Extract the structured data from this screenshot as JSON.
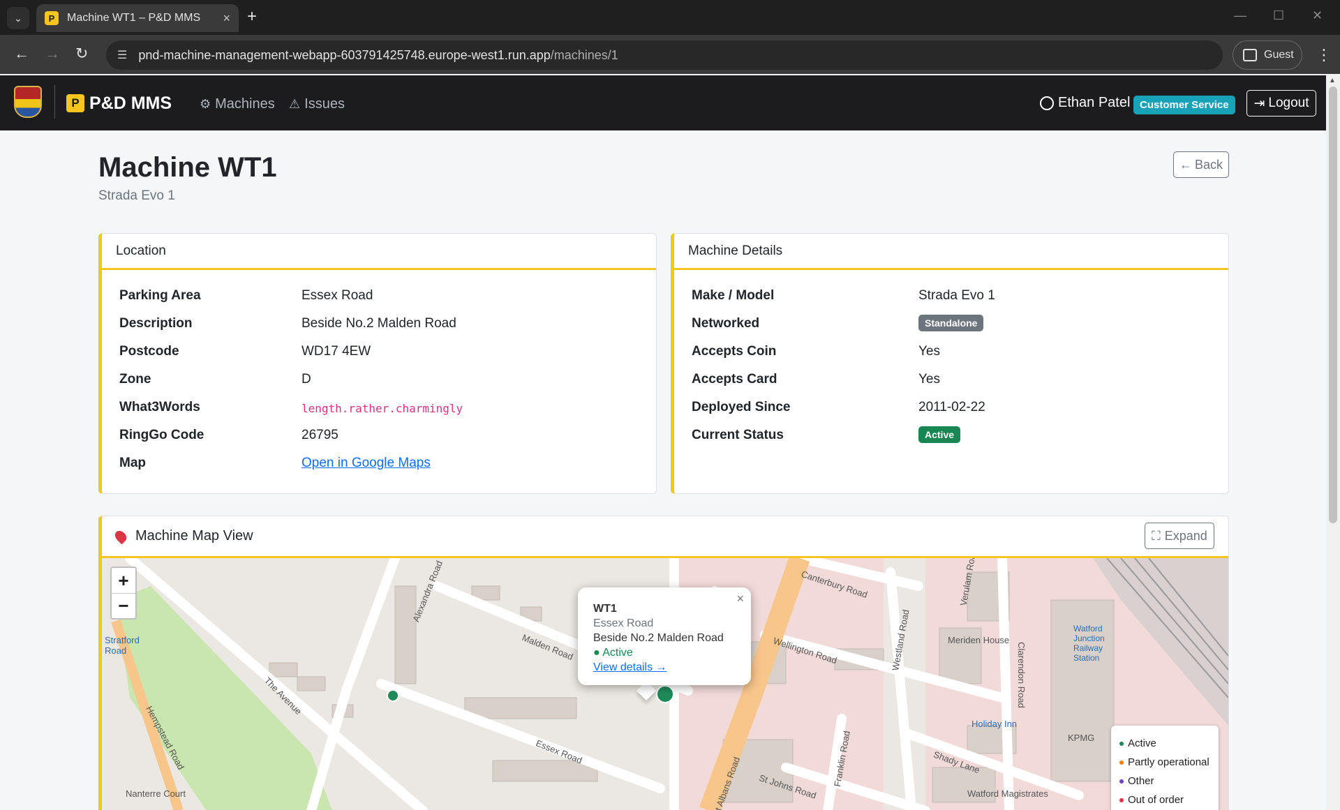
{
  "browser": {
    "tab_title": "Machine WT1 – P&D MMS",
    "url_host": "pnd-machine-management-webapp-603791425748.europe-west1.run.app",
    "url_path": "/machines/1",
    "profile_label": "Guest"
  },
  "navbar": {
    "brand_logo_letter": "P",
    "brand_name": "P&D MMS",
    "links": [
      {
        "label": "Machines",
        "icon": "cpu-icon"
      },
      {
        "label": "Issues",
        "icon": "warning-triangle-icon"
      }
    ],
    "user_name": "Ethan Patel",
    "user_role": "Customer Service",
    "logout_label": "Logout"
  },
  "page": {
    "title": "Machine WT1",
    "subtitle": "Strada Evo 1",
    "back_label": "Back"
  },
  "location_card": {
    "title": "Location",
    "rows": [
      {
        "label": "Parking Area",
        "value": "Essex Road"
      },
      {
        "label": "Description",
        "value": "Beside No.2 Malden Road"
      },
      {
        "label": "Postcode",
        "value": "WD17 4EW"
      },
      {
        "label": "Zone",
        "value": "D"
      },
      {
        "label": "What3Words",
        "value": "length.rather.charmingly"
      },
      {
        "label": "RingGo Code",
        "value": "26795"
      },
      {
        "label": "Map",
        "value": "Open in Google Maps"
      }
    ]
  },
  "details_card": {
    "title": "Machine Details",
    "rows": [
      {
        "label": "Make / Model",
        "value": "Strada Evo 1"
      },
      {
        "label": "Networked",
        "value": "Standalone"
      },
      {
        "label": "Accepts Coin",
        "value": "Yes"
      },
      {
        "label": "Accepts Card",
        "value": "Yes"
      },
      {
        "label": "Deployed Since",
        "value": "2011-02-22"
      },
      {
        "label": "Current Status",
        "value": "Active"
      }
    ]
  },
  "map_card": {
    "title": "Machine Map View",
    "expand_label": "Expand",
    "zoom_in": "+",
    "zoom_out": "−",
    "popup": {
      "title": "WT1",
      "area": "Essex Road",
      "description": "Beside No.2 Malden Road",
      "status": "● Active",
      "link": "View details →"
    },
    "legend": [
      {
        "label": "Active",
        "color": "#198754"
      },
      {
        "label": "Partly operational",
        "color": "#fd7e14"
      },
      {
        "label": "Other",
        "color": "#6f42c1"
      },
      {
        "label": "Out of order",
        "color": "#dc3545"
      }
    ],
    "labels": [
      "Malden Road",
      "Essex Road",
      "The Avenue",
      "Hempstead Road",
      "Alexandra Road",
      "Wellington Road",
      "Canterbury Road",
      "Westland Road",
      "Clarendon Road",
      "Shady Lane",
      "St Johns Road",
      "Franklin Road",
      "St Albans Road",
      "Meriden House",
      "KPMG",
      "Holiday Inn",
      "Watford Junction Railway Station",
      "Watford Magistrates",
      "Stratford Road",
      "Nanterre Court",
      "Verulam Road"
    ]
  },
  "colors": {
    "accent": "#f7c51e",
    "navbar_bg": "#1c1c1e",
    "badge_info": "#17a2b8",
    "badge_secondary": "#6c757d",
    "badge_success": "#198754"
  }
}
